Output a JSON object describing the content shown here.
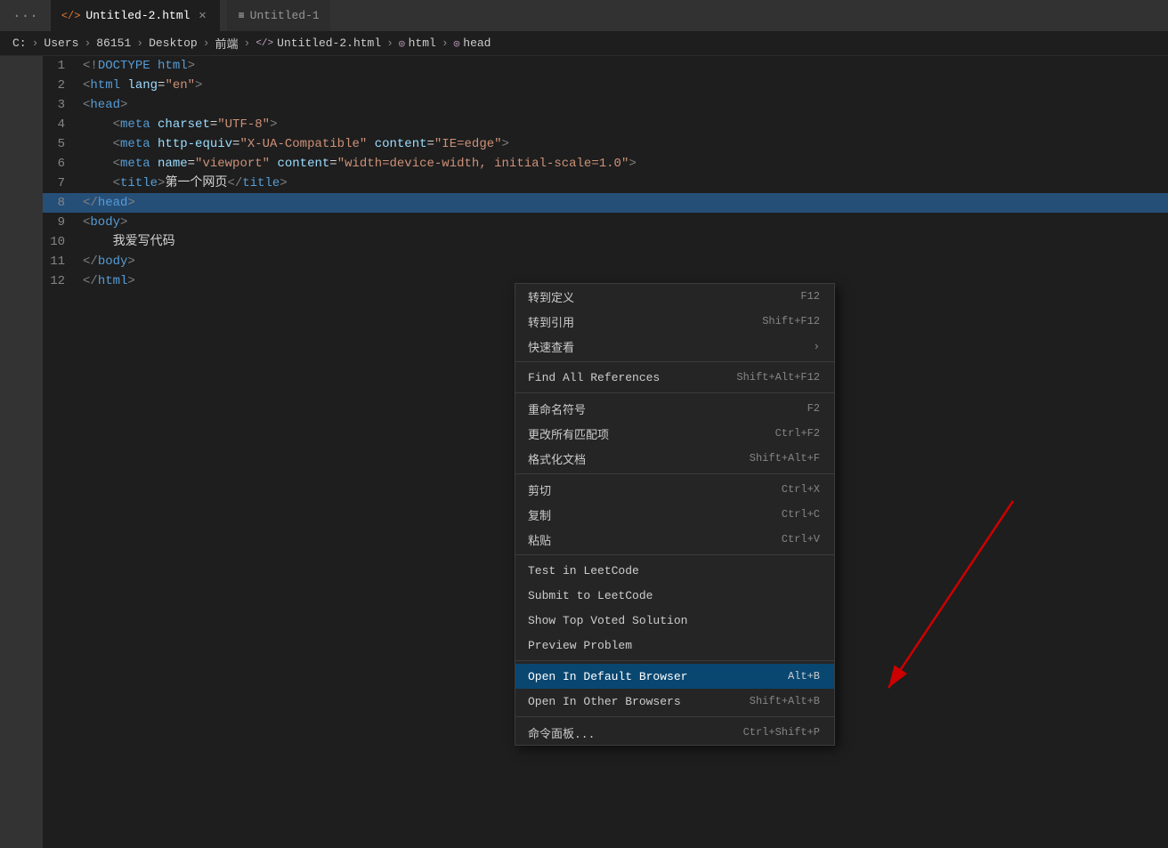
{
  "titleBar": {
    "dots": "...",
    "tabs": [
      {
        "id": "tab-untitled2",
        "icon": "html-icon",
        "iconSymbol": "</>",
        "label": "Untitled-2.html",
        "hasClose": true,
        "active": true
      },
      {
        "id": "tab-untitled1",
        "icon": "file-icon",
        "iconSymbol": "≡",
        "label": "Untitled-1",
        "hasClose": false,
        "active": false
      }
    ]
  },
  "breadcrumb": {
    "items": [
      "C:",
      "Users",
      "86151",
      "Desktop",
      "前端",
      "Untitled-2.html",
      "html",
      "head"
    ]
  },
  "codeLines": [
    {
      "num": 1,
      "content": "<!DOCTYPE html>",
      "html": "<span class='punct'>&lt;!</span><span class='kw'>DOCTYPE</span> <span class='kw'>html</span><span class='punct'>&gt;</span>"
    },
    {
      "num": 2,
      "content": "<html lang=\"en\">",
      "html": "<span class='punct'>&lt;</span><span class='kw'>html</span> <span class='attr'>lang</span>=<span class='str'>\"en\"</span><span class='punct'>&gt;</span>"
    },
    {
      "num": 3,
      "content": "<head>",
      "html": "<span class='punct'>&lt;</span><span class='kw'>head</span><span class='punct'>&gt;</span>"
    },
    {
      "num": 4,
      "content": "    <meta charset=\"UTF-8\">",
      "html": "    <span class='punct'>&lt;</span><span class='kw'>meta</span> <span class='attr'>charset</span>=<span class='str'>\"UTF-8\"</span><span class='punct'>&gt;</span>"
    },
    {
      "num": 5,
      "content": "    <meta http-equiv=\"X-UA-Compatible\" content=\"IE=edge\">",
      "html": "    <span class='punct'>&lt;</span><span class='kw'>meta</span> <span class='attr'>http-equiv</span>=<span class='str'>\"X-UA-Compatible\"</span> <span class='attr'>content</span>=<span class='str'>\"IE=edge\"</span><span class='punct'>&gt;</span>"
    },
    {
      "num": 6,
      "content": "    <meta name=\"viewport\" content=\"width=device-width, initial-scale=1.0\">",
      "html": "    <span class='punct'>&lt;</span><span class='kw'>meta</span> <span class='attr'>name</span>=<span class='str'>\"viewport\"</span> <span class='attr'>content</span>=<span class='str'>\"width=device-width, initial-scale=1.0\"</span><span class='punct'>&gt;</span>"
    },
    {
      "num": 7,
      "content": "    <title>第一个网页</title>",
      "html": "    <span class='punct'>&lt;</span><span class='kw'>title</span><span class='punct'>&gt;</span>第一个网页<span class='punct'>&lt;/</span><span class='kw'>title</span><span class='punct'>&gt;</span>"
    },
    {
      "num": 8,
      "content": "</head>",
      "html": "<span class='punct'>&lt;/</span><span class='kw'>head</span><span class='punct'>&gt;</span>",
      "highlighted": true
    },
    {
      "num": 9,
      "content": "<body>",
      "html": "<span class='punct'>&lt;</span><span class='kw'>body</span><span class='punct'>&gt;</span>"
    },
    {
      "num": 10,
      "content": "    我爱写代码",
      "html": "    我爱写代码"
    },
    {
      "num": 11,
      "content": "</body>",
      "html": "<span class='punct'>&lt;/</span><span class='kw'>body</span><span class='punct'>&gt;</span>"
    },
    {
      "num": 12,
      "content": "</html>",
      "html": "<span class='punct'>&lt;/</span><span class='kw'>html</span><span class='punct'>&gt;</span>"
    }
  ],
  "contextMenu": {
    "items": [
      {
        "id": "goto-def",
        "label": "转到定义",
        "shortcut": "F12",
        "hasSub": false,
        "separator_after": false
      },
      {
        "id": "goto-ref",
        "label": "转到引用",
        "shortcut": "Shift+F12",
        "hasSub": false,
        "separator_after": false
      },
      {
        "id": "quick-look",
        "label": "快速查看",
        "shortcut": "",
        "hasSub": true,
        "separator_after": true
      },
      {
        "id": "find-all-refs",
        "label": "Find All References",
        "shortcut": "Shift+Alt+F12",
        "hasSub": false,
        "separator_after": true
      },
      {
        "id": "rename",
        "label": "重命名符号",
        "shortcut": "F2",
        "hasSub": false,
        "separator_after": false
      },
      {
        "id": "change-all",
        "label": "更改所有匹配项",
        "shortcut": "Ctrl+F2",
        "hasSub": false,
        "separator_after": false
      },
      {
        "id": "format-doc",
        "label": "格式化文档",
        "shortcut": "Shift+Alt+F",
        "hasSub": false,
        "separator_after": true
      },
      {
        "id": "cut",
        "label": "剪切",
        "shortcut": "Ctrl+X",
        "hasSub": false,
        "separator_after": false
      },
      {
        "id": "copy",
        "label": "复制",
        "shortcut": "Ctrl+C",
        "hasSub": false,
        "separator_after": false
      },
      {
        "id": "paste",
        "label": "粘贴",
        "shortcut": "Ctrl+V",
        "hasSub": false,
        "separator_after": true
      },
      {
        "id": "test-leet",
        "label": "Test in LeetCode",
        "shortcut": "",
        "hasSub": false,
        "separator_after": false
      },
      {
        "id": "submit-leet",
        "label": "Submit to LeetCode",
        "shortcut": "",
        "hasSub": false,
        "separator_after": false
      },
      {
        "id": "top-voted",
        "label": "Show Top Voted Solution",
        "shortcut": "",
        "hasSub": false,
        "separator_after": false
      },
      {
        "id": "preview-prob",
        "label": "Preview Problem",
        "shortcut": "",
        "hasSub": false,
        "separator_after": true
      },
      {
        "id": "open-default",
        "label": "Open In Default Browser",
        "shortcut": "Alt+B",
        "hasSub": false,
        "separator_after": false,
        "highlighted": true
      },
      {
        "id": "open-other",
        "label": "Open In Other Browsers",
        "shortcut": "Shift+Alt+B",
        "hasSub": false,
        "separator_after": true
      },
      {
        "id": "cmd-palette",
        "label": "命令面板...",
        "shortcut": "Ctrl+Shift+P",
        "hasSub": false,
        "separator_after": false
      }
    ]
  },
  "colors": {
    "accent": "#094771",
    "highlighted": "#094771",
    "arrow": "#cc0000"
  }
}
